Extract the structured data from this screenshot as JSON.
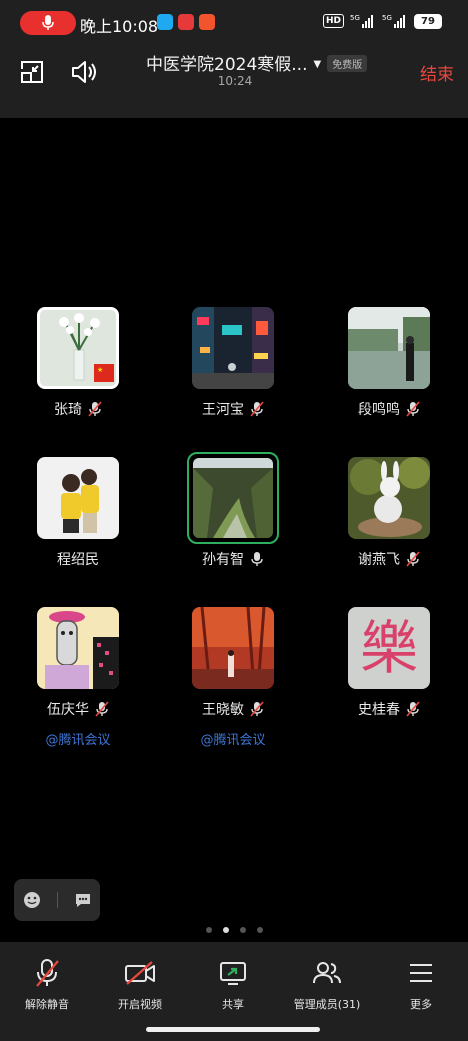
{
  "status_bar": {
    "time": "晚上10:08",
    "network": "5G",
    "battery": "79",
    "hd": "HD"
  },
  "header": {
    "title": "中医学院2024寒假...",
    "free_badge": "免费版",
    "duration": "10:24",
    "end_label": "结束"
  },
  "participants": [
    {
      "name": "张琦",
      "muted": true
    },
    {
      "name": "王河宝",
      "muted": true
    },
    {
      "name": "段鸣鸣",
      "muted": true
    },
    {
      "name": "程绍民",
      "muted": false
    },
    {
      "name": "孙有智",
      "muted": false,
      "speaking": true
    },
    {
      "name": "谢燕飞",
      "muted": true
    },
    {
      "name": "伍庆华",
      "muted": true,
      "watermark": "@腾讯会议"
    },
    {
      "name": "王晓敏",
      "muted": true,
      "watermark": "@腾讯会议"
    },
    {
      "name": "史桂春",
      "muted": true
    }
  ],
  "avatar_glyph_9": "樂",
  "pager": {
    "pages": 4,
    "active": 2
  },
  "toolbar": {
    "unmute": "解除静音",
    "start_video": "开启视频",
    "share": "共享",
    "members": "管理成员(31)",
    "more": "更多"
  },
  "colors": {
    "end": "#e8473e",
    "speaking_border": "#2fae5f",
    "watermark": "#3e76d6",
    "record": "#e8302e"
  }
}
